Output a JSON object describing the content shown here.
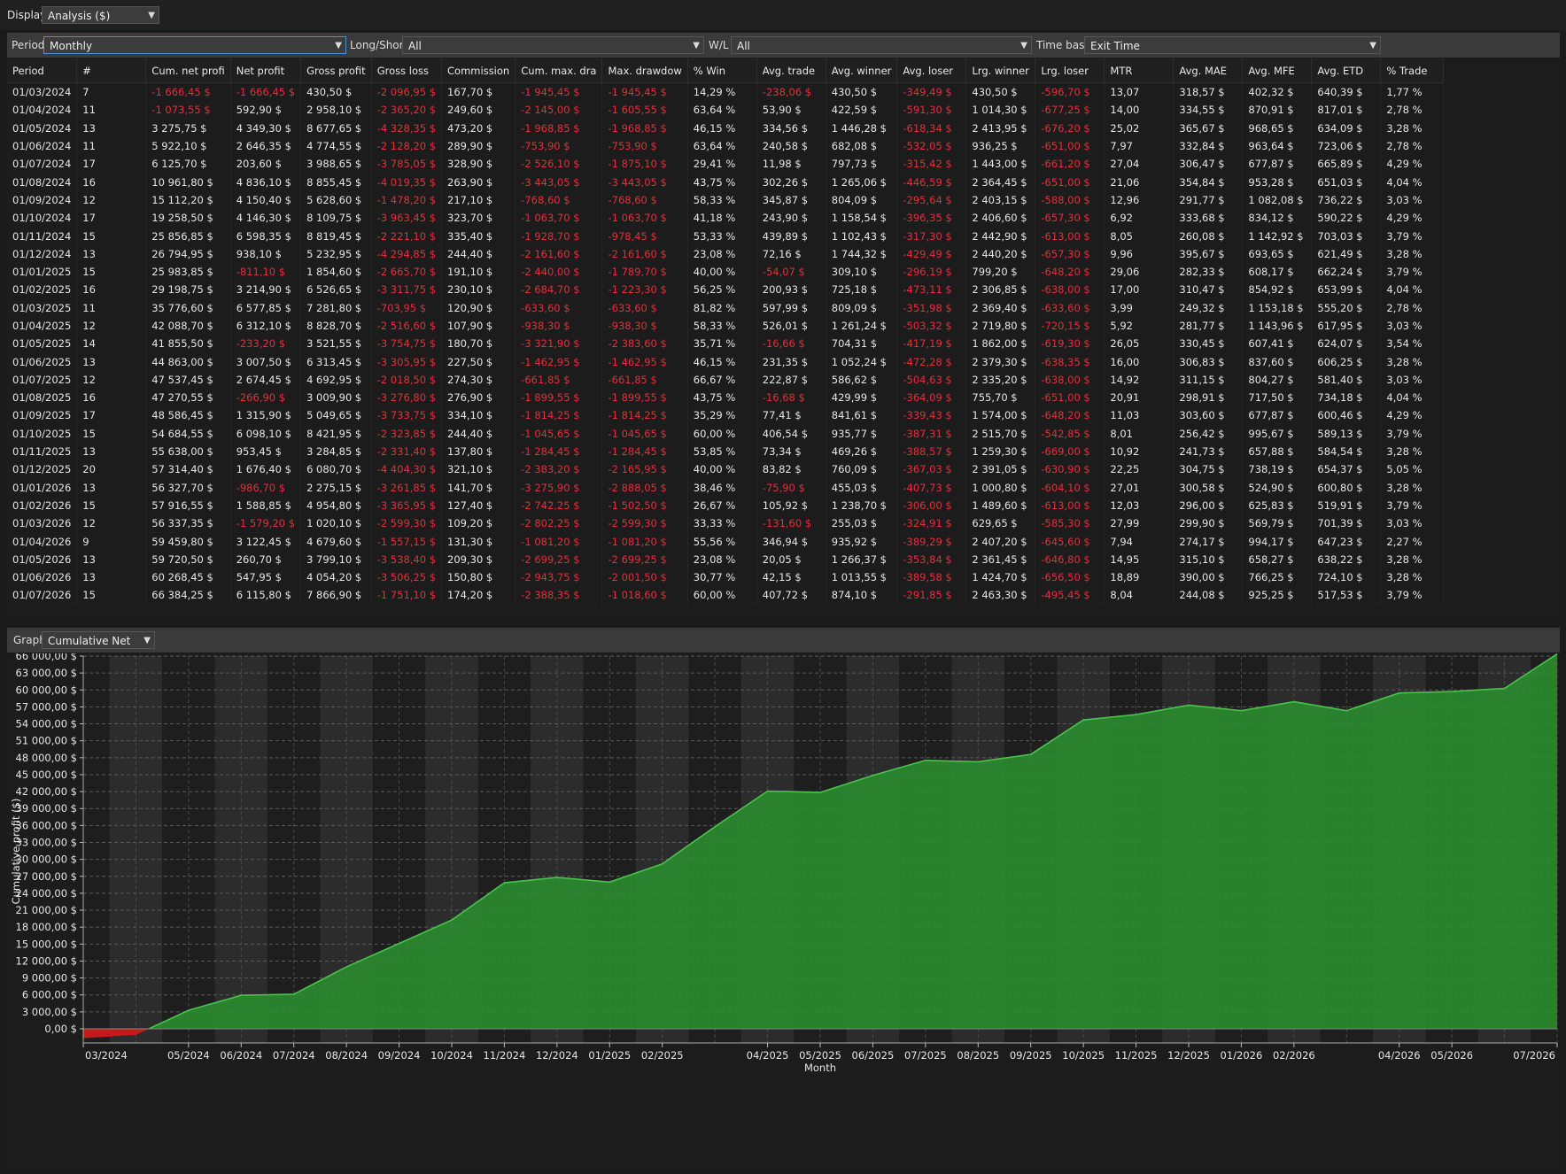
{
  "display": {
    "label": "Display",
    "value": "Analysis ($)"
  },
  "filters": {
    "period_label": "Period",
    "period_value": "Monthly",
    "longshort_label": "Long/Short",
    "longshort_value": "All",
    "wl_label": "W/L",
    "wl_value": "All",
    "timebase_label": "Time base",
    "timebase_value": "Exit Time"
  },
  "table": {
    "columns": [
      "Period",
      "#",
      "Cum. net profi",
      "Net profit",
      "Gross profit",
      "Gross loss",
      "Commission",
      "Cum. max. dra",
      "Max. drawdow",
      "% Win",
      "Avg. trade",
      "Avg. winner",
      "Avg. loser",
      "Lrg. winner",
      "Lrg. loser",
      "MTR",
      "Avg. MAE",
      "Avg. MFE",
      "Avg. ETD",
      "% Trade"
    ],
    "rows": [
      [
        "01/03/2024",
        "7",
        "-1 666,45 $",
        "-1 666,45 $",
        "430,50 $",
        "-2 096,95 $",
        "167,70 $",
        "-1 945,45 $",
        "-1 945,45 $",
        "14,29 %",
        "-238,06 $",
        "430,50 $",
        "-349,49 $",
        "430,50 $",
        "-596,70 $",
        "13,07",
        "318,57 $",
        "402,32 $",
        "640,39 $",
        "1,77 %"
      ],
      [
        "01/04/2024",
        "11",
        "-1 073,55 $",
        "592,90 $",
        "2 958,10 $",
        "-2 365,20 $",
        "249,60 $",
        "-2 145,00 $",
        "-1 605,55 $",
        "63,64 %",
        "53,90 $",
        "422,59 $",
        "-591,30 $",
        "1 014,30 $",
        "-677,25 $",
        "14,00",
        "334,55 $",
        "870,91 $",
        "817,01 $",
        "2,78 %"
      ],
      [
        "01/05/2024",
        "13",
        "3 275,75 $",
        "4 349,30 $",
        "8 677,65 $",
        "-4 328,35 $",
        "473,20 $",
        "-1 968,85 $",
        "-1 968,85 $",
        "46,15 %",
        "334,56 $",
        "1 446,28 $",
        "-618,34 $",
        "2 413,95 $",
        "-676,20 $",
        "25,02",
        "365,67 $",
        "968,65 $",
        "634,09 $",
        "3,28 %"
      ],
      [
        "01/06/2024",
        "11",
        "5 922,10 $",
        "2 646,35 $",
        "4 774,55 $",
        "-2 128,20 $",
        "289,90 $",
        "-753,90 $",
        "-753,90 $",
        "63,64 %",
        "240,58 $",
        "682,08 $",
        "-532,05 $",
        "936,25 $",
        "-651,00 $",
        "7,97",
        "332,84 $",
        "963,64 $",
        "723,06 $",
        "2,78 %"
      ],
      [
        "01/07/2024",
        "17",
        "6 125,70 $",
        "203,60 $",
        "3 988,65 $",
        "-3 785,05 $",
        "328,90 $",
        "-2 526,10 $",
        "-1 875,10 $",
        "29,41 %",
        "11,98 $",
        "797,73 $",
        "-315,42 $",
        "1 443,00 $",
        "-661,20 $",
        "27,04",
        "306,47 $",
        "677,87 $",
        "665,89 $",
        "4,29 %"
      ],
      [
        "01/08/2024",
        "16",
        "10 961,80 $",
        "4 836,10 $",
        "8 855,45 $",
        "-4 019,35 $",
        "263,90 $",
        "-3 443,05 $",
        "-3 443,05 $",
        "43,75 %",
        "302,26 $",
        "1 265,06 $",
        "-446,59 $",
        "2 364,45 $",
        "-651,00 $",
        "21,06",
        "354,84 $",
        "953,28 $",
        "651,03 $",
        "4,04 %"
      ],
      [
        "01/09/2024",
        "12",
        "15 112,20 $",
        "4 150,40 $",
        "5 628,60 $",
        "-1 478,20 $",
        "217,10 $",
        "-768,60 $",
        "-768,60 $",
        "58,33 %",
        "345,87 $",
        "804,09 $",
        "-295,64 $",
        "2 403,15 $",
        "-588,00 $",
        "12,96",
        "291,77 $",
        "1 082,08 $",
        "736,22 $",
        "3,03 %"
      ],
      [
        "01/10/2024",
        "17",
        "19 258,50 $",
        "4 146,30 $",
        "8 109,75 $",
        "-3 963,45 $",
        "323,70 $",
        "-1 063,70 $",
        "-1 063,70 $",
        "41,18 %",
        "243,90 $",
        "1 158,54 $",
        "-396,35 $",
        "2 406,60 $",
        "-657,30 $",
        "6,92",
        "333,68 $",
        "834,12 $",
        "590,22 $",
        "4,29 %"
      ],
      [
        "01/11/2024",
        "15",
        "25 856,85 $",
        "6 598,35 $",
        "8 819,45 $",
        "-2 221,10 $",
        "335,40 $",
        "-1 928,70 $",
        "-978,45 $",
        "53,33 %",
        "439,89 $",
        "1 102,43 $",
        "-317,30 $",
        "2 442,90 $",
        "-613,00 $",
        "8,05",
        "260,08 $",
        "1 142,92 $",
        "703,03 $",
        "3,79 %"
      ],
      [
        "01/12/2024",
        "13",
        "26 794,95 $",
        "938,10 $",
        "5 232,95 $",
        "-4 294,85 $",
        "244,40 $",
        "-2 161,60 $",
        "-2 161,60 $",
        "23,08 %",
        "72,16 $",
        "1 744,32 $",
        "-429,49 $",
        "2 440,20 $",
        "-657,30 $",
        "9,96",
        "395,67 $",
        "693,65 $",
        "621,49 $",
        "3,28 %"
      ],
      [
        "01/01/2025",
        "15",
        "25 983,85 $",
        "-811,10 $",
        "1 854,60 $",
        "-2 665,70 $",
        "191,10 $",
        "-2 440,00 $",
        "-1 789,70 $",
        "40,00 %",
        "-54,07 $",
        "309,10 $",
        "-296,19 $",
        "799,20 $",
        "-648,20 $",
        "29,06",
        "282,33 $",
        "608,17 $",
        "662,24 $",
        "3,79 %"
      ],
      [
        "01/02/2025",
        "16",
        "29 198,75 $",
        "3 214,90 $",
        "6 526,65 $",
        "-3 311,75 $",
        "230,10 $",
        "-2 684,70 $",
        "-1 223,30 $",
        "56,25 %",
        "200,93 $",
        "725,18 $",
        "-473,11 $",
        "2 306,85 $",
        "-638,00 $",
        "17,00",
        "310,47 $",
        "854,92 $",
        "653,99 $",
        "4,04 %"
      ],
      [
        "01/03/2025",
        "11",
        "35 776,60 $",
        "6 577,85 $",
        "7 281,80 $",
        "-703,95 $",
        "120,90 $",
        "-633,60 $",
        "-633,60 $",
        "81,82 %",
        "597,99 $",
        "809,09 $",
        "-351,98 $",
        "2 369,40 $",
        "-633,60 $",
        "3,99",
        "249,32 $",
        "1 153,18 $",
        "555,20 $",
        "2,78 %"
      ],
      [
        "01/04/2025",
        "12",
        "42 088,70 $",
        "6 312,10 $",
        "8 828,70 $",
        "-2 516,60 $",
        "107,90 $",
        "-938,30 $",
        "-938,30 $",
        "58,33 %",
        "526,01 $",
        "1 261,24 $",
        "-503,32 $",
        "2 719,80 $",
        "-720,15 $",
        "5,92",
        "281,77 $",
        "1 143,96 $",
        "617,95 $",
        "3,03 %"
      ],
      [
        "01/05/2025",
        "14",
        "41 855,50 $",
        "-233,20 $",
        "3 521,55 $",
        "-3 754,75 $",
        "180,70 $",
        "-3 321,90 $",
        "-2 383,60 $",
        "35,71 %",
        "-16,66 $",
        "704,31 $",
        "-417,19 $",
        "1 862,00 $",
        "-619,30 $",
        "26,05",
        "330,45 $",
        "607,41 $",
        "624,07 $",
        "3,54 %"
      ],
      [
        "01/06/2025",
        "13",
        "44 863,00 $",
        "3 007,50 $",
        "6 313,45 $",
        "-3 305,95 $",
        "227,50 $",
        "-1 462,95 $",
        "-1 462,95 $",
        "46,15 %",
        "231,35 $",
        "1 052,24 $",
        "-472,28 $",
        "2 379,30 $",
        "-638,35 $",
        "16,00",
        "306,83 $",
        "837,60 $",
        "606,25 $",
        "3,28 %"
      ],
      [
        "01/07/2025",
        "12",
        "47 537,45 $",
        "2 674,45 $",
        "4 692,95 $",
        "-2 018,50 $",
        "274,30 $",
        "-661,85 $",
        "-661,85 $",
        "66,67 %",
        "222,87 $",
        "586,62 $",
        "-504,63 $",
        "2 335,20 $",
        "-638,00 $",
        "14,92",
        "311,15 $",
        "804,27 $",
        "581,40 $",
        "3,03 %"
      ],
      [
        "01/08/2025",
        "16",
        "47 270,55 $",
        "-266,90 $",
        "3 009,90 $",
        "-3 276,80 $",
        "276,90 $",
        "-1 899,55 $",
        "-1 899,55 $",
        "43,75 %",
        "-16,68 $",
        "429,99 $",
        "-364,09 $",
        "755,70 $",
        "-651,00 $",
        "20,91",
        "298,91 $",
        "717,50 $",
        "734,18 $",
        "4,04 %"
      ],
      [
        "01/09/2025",
        "17",
        "48 586,45 $",
        "1 315,90 $",
        "5 049,65 $",
        "-3 733,75 $",
        "334,10 $",
        "-1 814,25 $",
        "-1 814,25 $",
        "35,29 %",
        "77,41 $",
        "841,61 $",
        "-339,43 $",
        "1 574,00 $",
        "-648,20 $",
        "11,03",
        "303,60 $",
        "677,87 $",
        "600,46 $",
        "4,29 %"
      ],
      [
        "01/10/2025",
        "15",
        "54 684,55 $",
        "6 098,10 $",
        "8 421,95 $",
        "-2 323,85 $",
        "244,40 $",
        "-1 045,65 $",
        "-1 045,65 $",
        "60,00 %",
        "406,54 $",
        "935,77 $",
        "-387,31 $",
        "2 515,70 $",
        "-542,85 $",
        "8,01",
        "256,42 $",
        "995,67 $",
        "589,13 $",
        "3,79 %"
      ],
      [
        "01/11/2025",
        "13",
        "55 638,00 $",
        "953,45 $",
        "3 284,85 $",
        "-2 331,40 $",
        "137,80 $",
        "-1 284,45 $",
        "-1 284,45 $",
        "53,85 %",
        "73,34 $",
        "469,26 $",
        "-388,57 $",
        "1 259,30 $",
        "-669,00 $",
        "10,92",
        "241,73 $",
        "657,88 $",
        "584,54 $",
        "3,28 %"
      ],
      [
        "01/12/2025",
        "20",
        "57 314,40 $",
        "1 676,40 $",
        "6 080,70 $",
        "-4 404,30 $",
        "321,10 $",
        "-2 383,20 $",
        "-2 165,95 $",
        "40,00 %",
        "83,82 $",
        "760,09 $",
        "-367,03 $",
        "2 391,05 $",
        "-630,90 $",
        "22,25",
        "304,75 $",
        "738,19 $",
        "654,37 $",
        "5,05 %"
      ],
      [
        "01/01/2026",
        "13",
        "56 327,70 $",
        "-986,70 $",
        "2 275,15 $",
        "-3 261,85 $",
        "141,70 $",
        "-3 275,90 $",
        "-2 888,05 $",
        "38,46 %",
        "-75,90 $",
        "455,03 $",
        "-407,73 $",
        "1 000,80 $",
        "-604,10 $",
        "27,01",
        "300,58 $",
        "524,90 $",
        "600,80 $",
        "3,28 %"
      ],
      [
        "01/02/2026",
        "15",
        "57 916,55 $",
        "1 588,85 $",
        "4 954,80 $",
        "-3 365,95 $",
        "127,40 $",
        "-2 742,25 $",
        "-1 502,50 $",
        "26,67 %",
        "105,92 $",
        "1 238,70 $",
        "-306,00 $",
        "1 489,60 $",
        "-613,00 $",
        "12,03",
        "296,00 $",
        "625,83 $",
        "519,91 $",
        "3,79 %"
      ],
      [
        "01/03/2026",
        "12",
        "56 337,35 $",
        "-1 579,20 $",
        "1 020,10 $",
        "-2 599,30 $",
        "109,20 $",
        "-2 802,25 $",
        "-2 599,30 $",
        "33,33 %",
        "-131,60 $",
        "255,03 $",
        "-324,91 $",
        "629,65 $",
        "-585,30 $",
        "27,99",
        "299,90 $",
        "569,79 $",
        "701,39 $",
        "3,03 %"
      ],
      [
        "01/04/2026",
        "9",
        "59 459,80 $",
        "3 122,45 $",
        "4 679,60 $",
        "-1 557,15 $",
        "131,30 $",
        "-1 081,20 $",
        "-1 081,20 $",
        "55,56 %",
        "346,94 $",
        "935,92 $",
        "-389,29 $",
        "2 407,20 $",
        "-645,60 $",
        "7,94",
        "274,17 $",
        "994,17 $",
        "647,23 $",
        "2,27 %"
      ],
      [
        "01/05/2026",
        "13",
        "59 720,50 $",
        "260,70 $",
        "3 799,10 $",
        "-3 538,40 $",
        "209,30 $",
        "-2 699,25 $",
        "-2 699,25 $",
        "23,08 %",
        "20,05 $",
        "1 266,37 $",
        "-353,84 $",
        "2 361,45 $",
        "-646,80 $",
        "14,95",
        "315,10 $",
        "658,27 $",
        "638,22 $",
        "3,28 %"
      ],
      [
        "01/06/2026",
        "13",
        "60 268,45 $",
        "547,95 $",
        "4 054,20 $",
        "-3 506,25 $",
        "150,80 $",
        "-2 943,75 $",
        "-2 001,50 $",
        "30,77 %",
        "42,15 $",
        "1 013,55 $",
        "-389,58 $",
        "1 424,70 $",
        "-656,50 $",
        "18,89",
        "390,00 $",
        "766,25 $",
        "724,10 $",
        "3,28 %"
      ],
      [
        "01/07/2026",
        "15",
        "66 384,25 $",
        "6 115,80 $",
        "7 866,90 $",
        "-1 751,10 $",
        "174,20 $",
        "-2 388,35 $",
        "-1 018,60 $",
        "60,00 %",
        "407,72 $",
        "874,10 $",
        "-291,85 $",
        "2 463,30 $",
        "-495,45 $",
        "8,04",
        "244,08 $",
        "925,25 $",
        "517,53 $",
        "3,79 %"
      ]
    ]
  },
  "graph": {
    "label": "Graph",
    "value": "Cumulative Net Profit"
  },
  "colors": {
    "positive_fill": "#2b8a2f",
    "positive_line": "#48c24d",
    "negative_fill": "#c41a1a",
    "negative_text": "#e0303a"
  },
  "chart_data": {
    "type": "area",
    "title": "",
    "xlabel": "Month",
    "ylabel": "Cumulative profit ($)",
    "ylim": [
      0,
      66000
    ],
    "yticks": [
      0,
      3000,
      6000,
      9000,
      12000,
      15000,
      18000,
      21000,
      24000,
      27000,
      30000,
      33000,
      36000,
      39000,
      42000,
      45000,
      48000,
      51000,
      54000,
      57000,
      60000,
      63000,
      66000
    ],
    "ytick_labels": [
      "0,00 $",
      "3 000,00 $",
      "6 000,00 $",
      "9 000,00 $",
      "12 000,00 $",
      "15 000,00 $",
      "18 000,00 $",
      "21 000,00 $",
      "24 000,00 $",
      "27 000,00 $",
      "30 000,00 $",
      "33 000,00 $",
      "36 000,00 $",
      "39 000,00 $",
      "42 000,00 $",
      "45 000,00 $",
      "48 000,00 $",
      "51 000,00 $",
      "54 000,00 $",
      "57 000,00 $",
      "60 000,00 $",
      "63 000,00 $",
      "66 000,00 $"
    ],
    "x_tick_labels": [
      "03/2024",
      "05/2024",
      "06/2024",
      "07/2024",
      "08/2024",
      "09/2024",
      "10/2024",
      "11/2024",
      "12/2024",
      "01/2025",
      "02/2025",
      "04/2025",
      "05/2025",
      "06/2025",
      "07/2025",
      "08/2025",
      "09/2025",
      "10/2025",
      "11/2025",
      "12/2025",
      "01/2026",
      "02/2026",
      "04/2026",
      "05/2026",
      "07/2026"
    ],
    "categories": [
      "03/2024",
      "04/2024",
      "05/2024",
      "06/2024",
      "07/2024",
      "08/2024",
      "09/2024",
      "10/2024",
      "11/2024",
      "12/2024",
      "01/2025",
      "02/2025",
      "03/2025",
      "04/2025",
      "05/2025",
      "06/2025",
      "07/2025",
      "08/2025",
      "09/2025",
      "10/2025",
      "11/2025",
      "12/2025",
      "01/2026",
      "02/2026",
      "03/2026",
      "04/2026",
      "05/2026",
      "06/2026",
      "07/2026"
    ],
    "values": [
      -1666.45,
      -1073.55,
      3275.75,
      5922.1,
      6125.7,
      10961.8,
      15112.2,
      19258.5,
      25856.85,
      26794.95,
      25983.85,
      29198.75,
      35776.6,
      42088.7,
      41855.5,
      44863.0,
      47537.45,
      47270.55,
      48586.45,
      54684.55,
      55638.0,
      57314.4,
      56327.7,
      57916.55,
      56337.35,
      59459.8,
      59720.5,
      60268.45,
      66384.25
    ],
    "grid": true,
    "legend": "none"
  }
}
